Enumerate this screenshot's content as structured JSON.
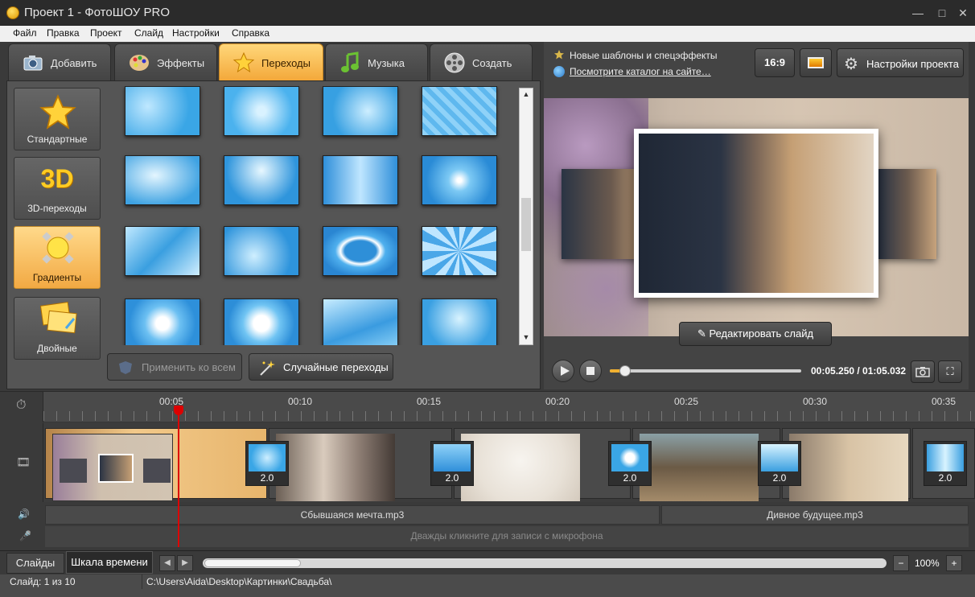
{
  "window": {
    "title": "Проект 1 - ФотоШОУ PRO",
    "min": "—",
    "max": "□",
    "close": "✕"
  },
  "menu": [
    "Файл",
    "Правка",
    "Проект",
    "Слайд",
    "Настройки",
    "Справка"
  ],
  "tabs": [
    {
      "label": "Добавить",
      "icon": "camera-icon"
    },
    {
      "label": "Эффекты",
      "icon": "palette-icon"
    },
    {
      "label": "Переходы",
      "icon": "star-icon",
      "active": true
    },
    {
      "label": "Музыка",
      "icon": "music-note-icon"
    },
    {
      "label": "Создать",
      "icon": "film-reel-icon"
    }
  ],
  "categories": [
    {
      "label": "Стандартные",
      "icon": "star-icon"
    },
    {
      "label": "3D-переходы",
      "icon": "3d-icon",
      "glyph": "3D"
    },
    {
      "label": "Градиенты",
      "icon": "gradient-sun-icon",
      "active": true
    },
    {
      "label": "Двойные",
      "icon": "double-cards-icon"
    }
  ],
  "panel_buttons": {
    "apply_all": "Применить ко всем",
    "random": "Случайные переходы"
  },
  "info": {
    "new_templates": "Новые шаблоны и спецэффекты",
    "catalog_link": "Посмотрите каталог на сайте…"
  },
  "top_right": {
    "aspect": "16:9",
    "settings": "Настройки проекта"
  },
  "preview": {
    "edit_slide": "Редактировать слайд"
  },
  "player": {
    "time": "00:05.250 / 01:05.032",
    "progress": 0.08
  },
  "ruler": {
    "ticks": [
      "00:05",
      "00:10",
      "00:15",
      "00:20",
      "00:25",
      "00:30",
      "00:35"
    ]
  },
  "transitions": [
    "2.0",
    "2.0",
    "2.0",
    "2.0",
    "2.0"
  ],
  "audio": {
    "track1": "Сбывшаяся мечта.mp3",
    "track2": "Дивное будущее.mp3",
    "mic_hint": "Дважды кликните для записи с микрофона"
  },
  "bottom": {
    "tab_slides": "Слайды",
    "tab_timeline": "Шкала времени",
    "zoom": "100%",
    "minus": "−",
    "plus": "+"
  },
  "status": {
    "slide": "Слайд: 1 из 10",
    "path": "C:\\Users\\Aida\\Desktop\\Картинки\\Свадьба\\"
  }
}
